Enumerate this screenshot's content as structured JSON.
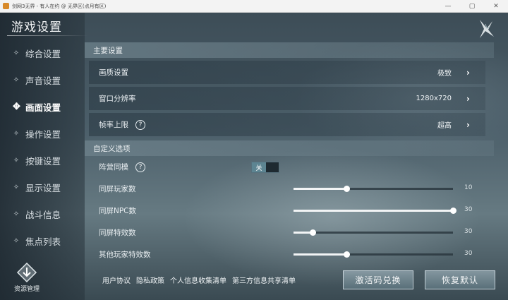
{
  "window": {
    "title": "剑网3无界 - 有人在约 @ 无界区(点月有区)",
    "minimize": "—",
    "maximize": "▢",
    "close": "✕"
  },
  "page_title": "游戏设置",
  "sidebar": {
    "items": [
      {
        "label": "综合设置",
        "active": false
      },
      {
        "label": "声音设置",
        "active": false
      },
      {
        "label": "画面设置",
        "active": true
      },
      {
        "label": "操作设置",
        "active": false
      },
      {
        "label": "按键设置",
        "active": false
      },
      {
        "label": "显示设置",
        "active": false
      },
      {
        "label": "战斗信息",
        "active": false
      },
      {
        "label": "焦点列表",
        "active": false
      }
    ],
    "resource_button": "资源管理"
  },
  "main": {
    "section1": {
      "title": "主要设置",
      "rows": [
        {
          "label": "画质设置",
          "value": "极致"
        },
        {
          "label": "窗口分辨率",
          "value": "1280x720"
        },
        {
          "label": "帧率上限",
          "value": "超高",
          "help": "?"
        }
      ]
    },
    "section2": {
      "title": "自定义选项",
      "camp": {
        "label": "阵营同模",
        "help": "?",
        "toggle": "关",
        "on": false
      },
      "sliders": [
        {
          "label": "同屏玩家数",
          "value": "10",
          "fraction": 0.33
        },
        {
          "label": "同屏NPC数",
          "value": "30",
          "fraction": 1.0
        },
        {
          "label": "同屏特效数",
          "value": "30",
          "fraction": 0.12
        },
        {
          "label": "其他玩家特效数",
          "value": "30",
          "fraction": 0.33
        }
      ]
    }
  },
  "footer": {
    "links": [
      "用户协议",
      "隐私政策",
      "个人信息收集清单",
      "第三方信息共享清单"
    ],
    "activate_button": "激活码兑换",
    "reset_button": "恢复默认"
  }
}
